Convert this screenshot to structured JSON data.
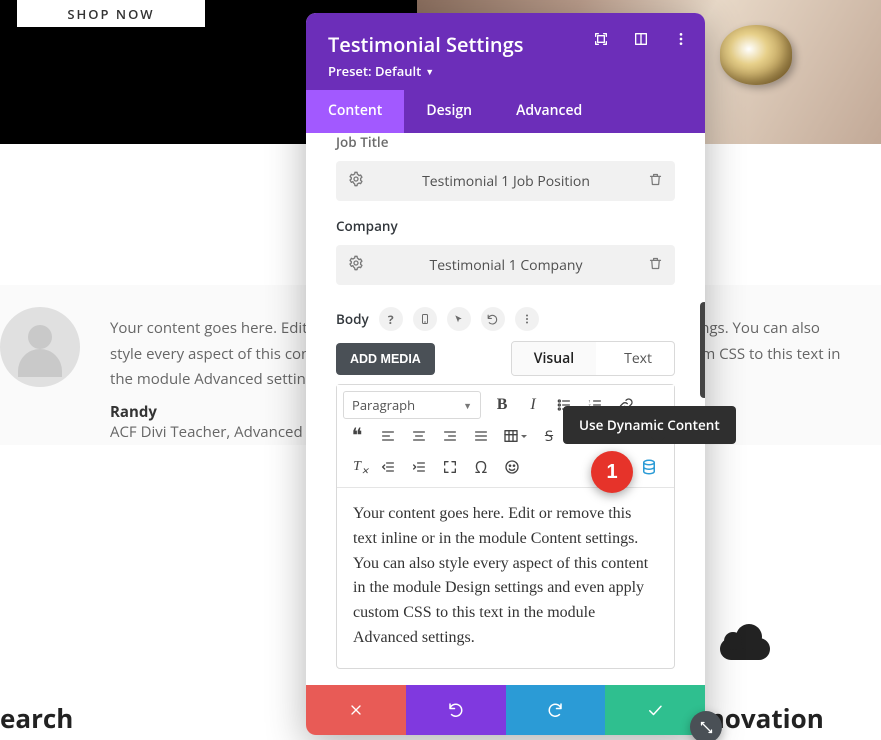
{
  "bg": {
    "shop_now": "SHOP NOW",
    "testimonial_text": "Your content goes here. Edit or remove this text inline or in the module Content settings. You can also style every aspect of this content in the module Design settings and even apply custom CSS to this text in the module Advanced settings.",
    "author_name": "Randy",
    "author_role": "ACF Divi Teacher, Advanced Custom",
    "heading_left": "earch",
    "heading_right": "Innovation"
  },
  "modal": {
    "title": "Testimonial Settings",
    "preset_label": "Preset: Default",
    "tabs": {
      "content": "Content",
      "design": "Design",
      "advanced": "Advanced"
    },
    "fields": {
      "job_title_label": "Job Title",
      "job_title_value": "Testimonial 1 Job Position",
      "company_label": "Company",
      "company_value": "Testimonial 1 Company",
      "body_label": "Body"
    },
    "add_media": "ADD MEDIA",
    "vt": {
      "visual": "Visual",
      "text": "Text"
    },
    "format_dropdown": "Paragraph",
    "body_content": "Your content goes here. Edit or remove this text inline or in the module Content settings. You can also style every aspect of this content in the module Design settings and even apply custom CSS to this text in the module Advanced settings."
  },
  "tooltip": {
    "dynamic": "Use Dynamic Content"
  },
  "marker": {
    "one": "1"
  }
}
